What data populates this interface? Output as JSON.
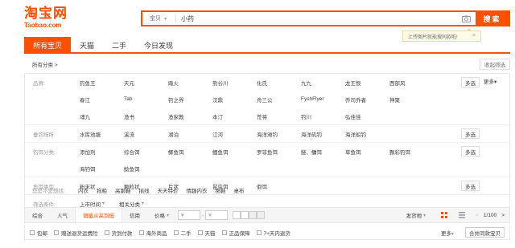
{
  "logo": {
    "cn": "淘宝网",
    "en": "Taobao.com"
  },
  "search": {
    "category": "宝贝",
    "value": "小药",
    "button": "搜索",
    "tip": "上传图片就能搜同款啦!",
    "tip_close": "×"
  },
  "tabs": [
    "所有宝贝",
    "天猫",
    "二手",
    "今日发现"
  ],
  "breadcrumb": {
    "label": "所有分类",
    "sep": ">",
    "collapse": "收起筛选"
  },
  "attributes": [
    {
      "key": "品牌:",
      "values": [
        "钓鱼王",
        "天元",
        "飚火",
        "熊谷川",
        "化氏",
        "九九",
        "龙王恨",
        "西部风",
        "春江",
        "Tab",
        "钓之界",
        "汉鼎",
        "舟三公",
        "FyshFlyer",
        "乔司乔者",
        "神聚",
        "魂九",
        "渔书",
        "渔家教",
        "本汀",
        "荒将",
        "钓川",
        "弘佳佳"
      ],
      "multi": "多选",
      "more": "更多"
    },
    {
      "key": "垂钓场所:",
      "values": [
        "水库池塘",
        "溪流",
        "湖泊",
        "江河",
        "海洋滩钓",
        "海洋矶钓",
        "海洋船钓"
      ],
      "multi": "多选"
    },
    {
      "key": "钓饵分类:",
      "values": [
        "添加剂",
        "综合饵",
        "鲫鱼饵",
        "鲤鱼饵",
        "罗非鱼饵",
        "鲢、鳙饵",
        "草鱼饵",
        "飘彩钓饵",
        "海钓饵",
        "鲶鱼饵"
      ],
      "multi": "多选"
    },
    {
      "key": "鱼饵类型:",
      "values": [
        "粉末状",
        "颗粒状",
        "片状",
        "昆虫饵",
        "假饵"
      ],
      "multi": "多选"
    },
    {
      "key": "筛选条件:",
      "dropdowns": [
        "上市时间",
        "相关分类"
      ]
    }
  ],
  "want": {
    "key": "您是不是想找:",
    "items": [
      "内衣",
      "狗粮",
      "高跟鞋",
      "插线",
      "天天特价",
      "情趣内衣",
      "拖鞋",
      "桌布"
    ]
  },
  "sort": {
    "items": [
      "综合",
      "人气",
      "销量从高到低",
      "信用",
      "价格"
    ],
    "price_from": "¥",
    "price_to": "¥",
    "price_sep": "-",
    "ship": "发货地",
    "page": "1/100"
  },
  "filters": [
    "包邮",
    "赠送退货运费险",
    "货到付款",
    "海外商品",
    "二手",
    "天猫",
    "正品保障",
    "7+天内退货"
  ],
  "filters_more": "更多",
  "merge": "合并同款宝贝",
  "colors": {
    "accent": "#ff5000"
  }
}
